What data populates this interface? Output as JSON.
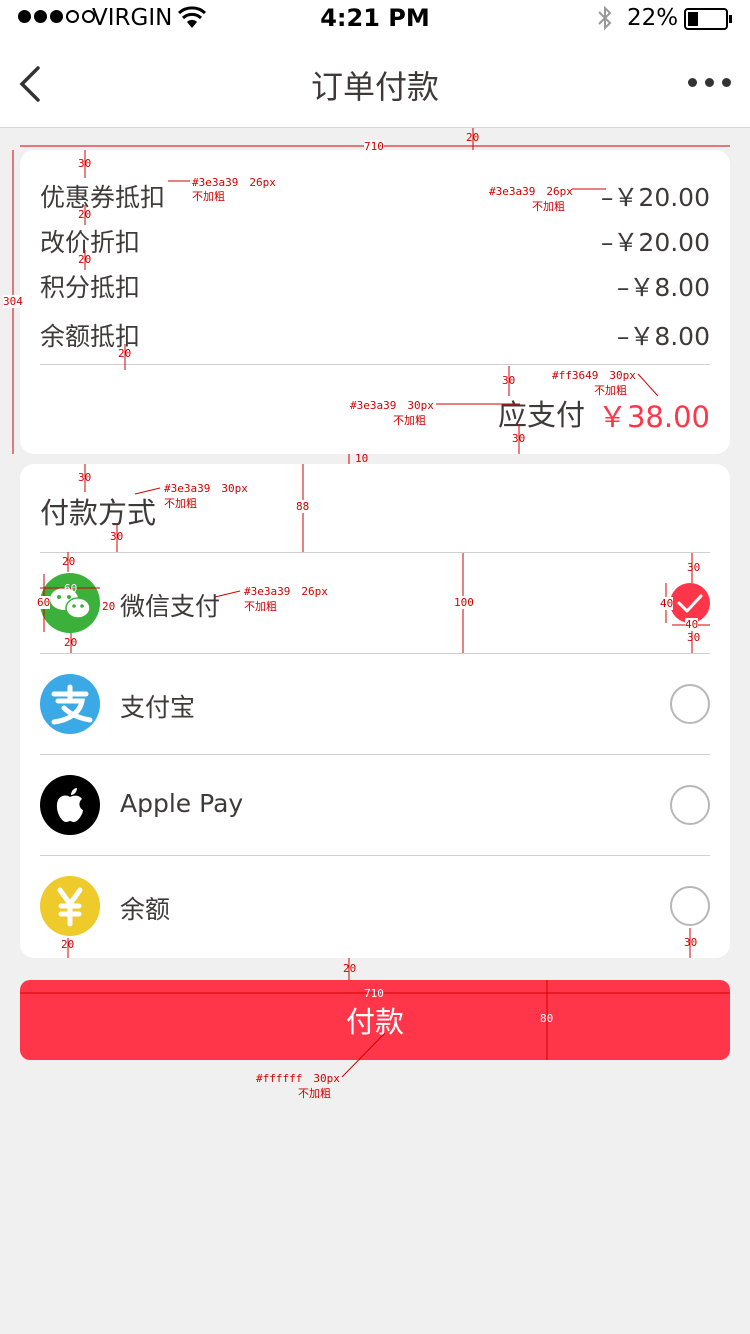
{
  "status_bar": {
    "carrier": "VIRGIN",
    "time": "4:21 PM",
    "battery_percent": "22%",
    "signal_bars": 3
  },
  "nav": {
    "title": "订单付款",
    "back_icon": "chevron-left-icon",
    "more_icon": "more-dots-icon"
  },
  "summary": {
    "rows": [
      {
        "label": "优惠券抵扣",
        "value": "–￥20.00"
      },
      {
        "label": "改价折扣",
        "value": "–￥20.00"
      },
      {
        "label": "积分抵扣",
        "value": "–￥8.00"
      },
      {
        "label": "余额抵扣",
        "value": "–￥8.00"
      }
    ],
    "total_label": "应支付",
    "total_value": "￥38.00"
  },
  "payment": {
    "heading": "付款方式",
    "methods": [
      {
        "name": "微信支付",
        "icon": "wechat-icon",
        "color": "#3bb13b",
        "selected": true
      },
      {
        "name": "支付宝",
        "icon": "alipay-icon",
        "color": "#3aa9e6",
        "selected": false
      },
      {
        "name": "Apple Pay",
        "icon": "apple-icon",
        "color": "#000000",
        "selected": false
      },
      {
        "name": "余额",
        "icon": "yuan-icon",
        "color": "#efca2b",
        "selected": false
      }
    ]
  },
  "pay_button": {
    "label": "付款"
  },
  "colors": {
    "text": "#3e3a39",
    "accent": "#ff3649",
    "background": "#f0f0f0"
  },
  "annotations": {
    "nav_gap": "20",
    "card_width": "710",
    "card1_pad_top": "30",
    "font_26_left": "#3e3a39　26px",
    "bold_no_left": "不加粗",
    "font_26_right": "#3e3a39　26px",
    "bold_no_right": "不加粗",
    "row_gap_1": "20",
    "row_gap_2": "20",
    "card1_height": "304",
    "row_gap_3": "20",
    "divider_gap_top": "30",
    "total_color": "#ff3649　30px",
    "bold_no_total": "不加粗",
    "total_label_font": "#3e3a39　30px",
    "bold_no_total_label": "不加粗",
    "divider_gap_bottom": "30",
    "card_gap": "10",
    "card2_pad_top": "30",
    "heading_font": "#3e3a39　30px",
    "bold_no_heading": "不加粗",
    "heading_height": "88",
    "heading_pad_bottom": "30",
    "icon_pad_top": "20",
    "icon_size_w": "60",
    "icon_size_h": "60",
    "icon_gap": "20",
    "method_font": "#3e3a39　26px",
    "bold_no_method": "不加粗",
    "row_height": "100",
    "check_pad_top": "30",
    "check_size_h": "40",
    "check_size_w": "40",
    "check_pad_bottom": "30",
    "icon_pad_bottom": "20",
    "last_icon_pad": "20",
    "last_radio_pad": "30",
    "button_gap": "20",
    "button_width": "710",
    "button_height": "80",
    "button_font": "#ffffff　30px",
    "bold_no_button": "不加粗"
  }
}
